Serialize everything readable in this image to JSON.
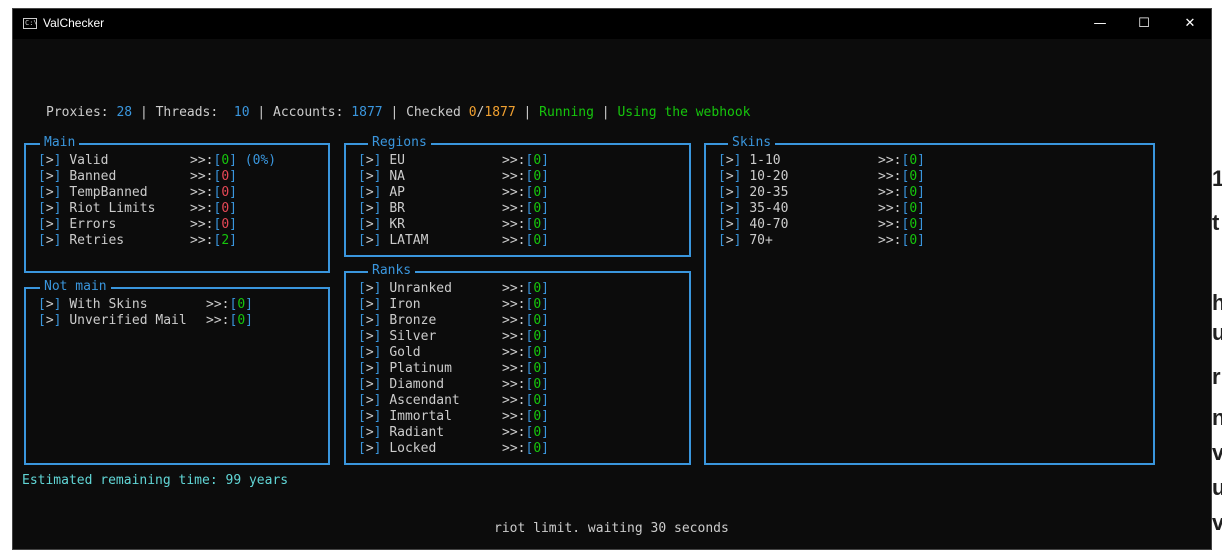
{
  "window": {
    "title": "ValChecker",
    "minimize": "—",
    "maximize": "☐",
    "close": "✕"
  },
  "status": {
    "proxies_label": "Proxies:",
    "proxies": "28",
    "threads_label": "Threads:",
    "threads": "10",
    "accounts_label": "Accounts:",
    "accounts": "1877",
    "checked_label": "Checked",
    "checked": "0",
    "checked_total": "1877",
    "sep": "|",
    "slash": "/",
    "state": "Running",
    "webhook": "Using the webhook"
  },
  "main": {
    "title": "Main",
    "items": [
      {
        "label": "Valid",
        "value": "0",
        "extra": "(0%)"
      },
      {
        "label": "Banned",
        "value": "0"
      },
      {
        "label": "TempBanned",
        "value": "0"
      },
      {
        "label": "Riot Limits",
        "value": "0"
      },
      {
        "label": "Errors",
        "value": "0"
      },
      {
        "label": "Retries",
        "value": "2"
      }
    ]
  },
  "not_main": {
    "title": "Not main",
    "items": [
      {
        "label": "With Skins",
        "value": "0"
      },
      {
        "label": "Unverified Mail",
        "value": "0"
      }
    ]
  },
  "regions": {
    "title": "Regions",
    "items": [
      {
        "label": "EU",
        "value": "0"
      },
      {
        "label": "NA",
        "value": "0"
      },
      {
        "label": "AP",
        "value": "0"
      },
      {
        "label": "BR",
        "value": "0"
      },
      {
        "label": "KR",
        "value": "0"
      },
      {
        "label": "LATAM",
        "value": "0"
      }
    ]
  },
  "ranks": {
    "title": "Ranks",
    "items": [
      {
        "label": "Unranked",
        "value": "0"
      },
      {
        "label": "Iron",
        "value": "0"
      },
      {
        "label": "Bronze",
        "value": "0"
      },
      {
        "label": "Silver",
        "value": "0"
      },
      {
        "label": "Gold",
        "value": "0"
      },
      {
        "label": "Platinum",
        "value": "0"
      },
      {
        "label": "Diamond",
        "value": "0"
      },
      {
        "label": "Ascendant",
        "value": "0"
      },
      {
        "label": "Immortal",
        "value": "0"
      },
      {
        "label": "Radiant",
        "value": "0"
      },
      {
        "label": "Locked",
        "value": "0"
      }
    ]
  },
  "skins": {
    "title": "Skins",
    "items": [
      {
        "label": "1-10",
        "value": "0"
      },
      {
        "label": "10-20",
        "value": "0"
      },
      {
        "label": "20-35",
        "value": "0"
      },
      {
        "label": "35-40",
        "value": "0"
      },
      {
        "label": "40-70",
        "value": "0"
      },
      {
        "label": "70+",
        "value": "0"
      }
    ]
  },
  "symbols": {
    "bullet_open": "[",
    "bullet_mark": ">",
    "bullet_close": "]",
    "arrow": ">>:",
    "val_open": "[",
    "val_close": "]"
  },
  "estimate": "Estimated remaining time: 99 years",
  "message": "riot limit. waiting 30 seconds",
  "background": {
    "glyphs": [
      "1",
      "t",
      "h",
      "u",
      "r",
      "n",
      "v",
      "u",
      "v"
    ]
  },
  "colors": {
    "accent": "#3a96dd",
    "value_green": "#16c60c",
    "error_red": "#e74856",
    "orange": "#f0a030",
    "cyan": "#61d6d6",
    "background": "#0c0c0c"
  }
}
